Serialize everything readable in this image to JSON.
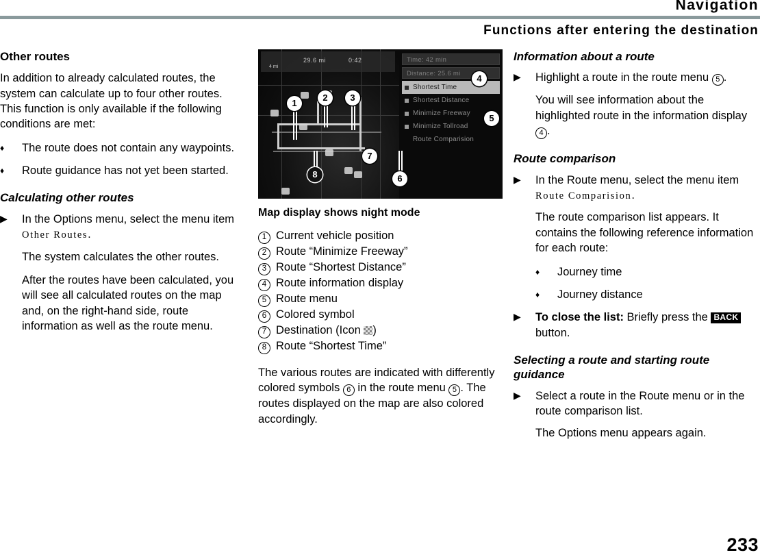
{
  "header": {
    "title": "Navigation",
    "section": "Functions after entering the destination"
  },
  "page_number": "233",
  "left_column": {
    "heading": "Other routes",
    "intro": "In addition to already calculated routes, the system can calculate up to four other routes. This function is only available if the following conditions are met:",
    "conditions": [
      "The route does not contain any waypoints.",
      "Route guidance has not yet been started."
    ],
    "subheading": "Calculating other routes",
    "step_prefix": "In the Options menu, select the menu item ",
    "step_menu_item": "Other Routes",
    "step_suffix": ".",
    "result_1": "The system calculates the other routes.",
    "result_2": "After the routes have been calculated, you will see all calculated routes on the map and, on the right-hand side, route information as well as the route menu."
  },
  "figure": {
    "caption": "Map display shows night mode",
    "map": {
      "status_distance": "29.6 mi",
      "status_time": "0:42",
      "status_scale": "4 mi"
    },
    "menu": {
      "info_rows": [
        "Time: 42 min",
        "Distance: 25.6 mi"
      ],
      "items": [
        {
          "label": "Shortest Time",
          "selected": true
        },
        {
          "label": "Shortest Distance",
          "selected": false
        },
        {
          "label": "Minimize Freeway",
          "selected": false
        },
        {
          "label": "Minimize Tollroad",
          "selected": false
        },
        {
          "label": "Route Comparision",
          "selected": false
        }
      ]
    },
    "callouts": [
      "1",
      "2",
      "3",
      "4",
      "5",
      "6",
      "7",
      "8"
    ]
  },
  "legend": [
    {
      "num": "1",
      "label": "Current vehicle position"
    },
    {
      "num": "2",
      "label": "Route “Minimize Freeway”"
    },
    {
      "num": "3",
      "label": "Route “Shortest Distance”"
    },
    {
      "num": "4",
      "label": "Route information display"
    },
    {
      "num": "5",
      "label": "Route menu"
    },
    {
      "num": "6",
      "label": "Colored symbol"
    },
    {
      "num": "7",
      "label": "Destination (Icon "
    },
    {
      "num": "8",
      "label": "Route “Shortest Time”"
    }
  ],
  "legend_7_suffix": ")",
  "center_column": {
    "note_part1": "The various routes are indicated with differently colored symbols ",
    "note_num1": "6",
    "note_part2": " in the route menu ",
    "note_num2": "5",
    "note_part3": ". The routes displayed on the map are also colored accordingly."
  },
  "right_column": {
    "info_heading": "Information about a route",
    "info_step_part1": "Highlight a route in the route menu ",
    "info_step_num": "5",
    "info_step_part2": ".",
    "info_result_part1": "You will see information about the highlighted route in the information display ",
    "info_result_num": "4",
    "info_result_part2": ".",
    "comparison_heading": "Route comparison",
    "comparison_step_prefix": "In the Route menu, select the menu item ",
    "comparison_menu_item": "Route Comparision",
    "comparison_step_suffix": ".",
    "comparison_result": "The route comparison list appears. It contains the following reference information for each route:",
    "comparison_bullets": [
      "Journey time",
      "Journey distance"
    ],
    "close_label": "To close the list:",
    "close_text_1": " Briefly press the ",
    "close_key": "BACK",
    "close_text_2": " button.",
    "selecting_heading": "Selecting a route and starting route guidance",
    "selecting_step": "Select a route in the Route menu or in the route comparison list.",
    "selecting_result": "The Options menu appears again."
  },
  "symbols": {
    "bullet_diamond": "♦",
    "step_arrow": "▶"
  }
}
